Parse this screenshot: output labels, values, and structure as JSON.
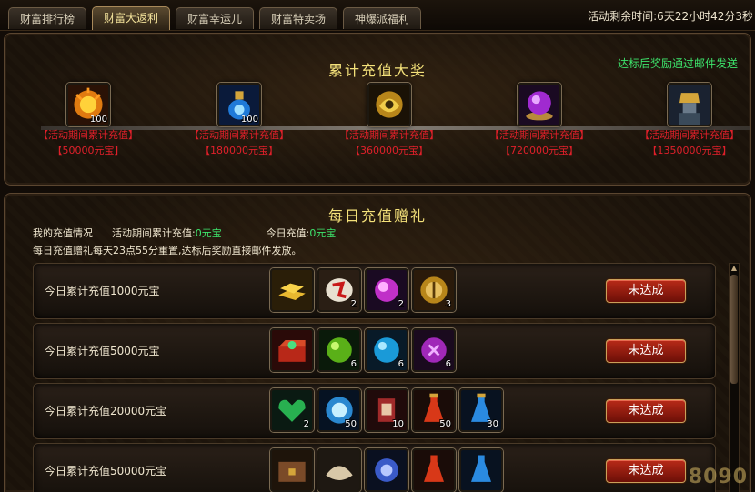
{
  "tabs": [
    {
      "label": "财富排行榜",
      "active": false
    },
    {
      "label": "财富大返利",
      "active": true
    },
    {
      "label": "财富幸运儿",
      "active": false
    },
    {
      "label": "财富特卖场",
      "active": false
    },
    {
      "label": "神爆派福利",
      "active": false
    }
  ],
  "timer": "活动剩余时间:6天22小时42分3秒",
  "cumulative": {
    "title": "累计充值大奖",
    "note": "达标后奖励通过邮件发送",
    "milestones": [
      {
        "icon": "fire-orb-icon",
        "qty": "100",
        "condition": "【活动期间累计充值】",
        "amount": "【50000元宝】"
      },
      {
        "icon": "blue-potion-icon",
        "qty": "100",
        "condition": "【活动期间累计充值】",
        "amount": "【180000元宝】"
      },
      {
        "icon": "gold-dragon-icon",
        "qty": "",
        "condition": "【活动期间累计充值】",
        "amount": "【360000元宝】"
      },
      {
        "icon": "purple-orb-icon",
        "qty": "",
        "condition": "【活动期间累计充值】",
        "amount": "【720000元宝】"
      },
      {
        "icon": "golden-warrior-icon",
        "qty": "",
        "condition": "【活动期间累计充值】",
        "amount": "【1350000元宝】"
      }
    ]
  },
  "daily": {
    "title": "每日充值赠礼",
    "my_status_label": "我的充值情况",
    "period_label": "活动期间累计充值:",
    "period_value": "0元宝",
    "today_label": "今日充值:",
    "today_value": "0元宝",
    "notice": "每日充值赠礼每天23点55分重置,达标后奖励直接邮件发放。",
    "rows": [
      {
        "label": "今日累计充值1000元宝",
        "status": "未达成",
        "items": [
          {
            "icon": "gold-bars-icon",
            "qty": ""
          },
          {
            "icon": "red-rune-stone-icon",
            "qty": "2"
          },
          {
            "icon": "pink-crystal-icon",
            "qty": "2"
          },
          {
            "icon": "golden-compass-icon",
            "qty": "3"
          }
        ]
      },
      {
        "label": "今日累计充值5000元宝",
        "status": "未达成",
        "items": [
          {
            "icon": "treasure-chest-icon",
            "qty": ""
          },
          {
            "icon": "green-orb-icon",
            "qty": "6"
          },
          {
            "icon": "blue-orb-icon",
            "qty": "6"
          },
          {
            "icon": "purple-rune-orb-icon",
            "qty": "6"
          }
        ]
      },
      {
        "label": "今日累计充值20000元宝",
        "status": "未达成",
        "items": [
          {
            "icon": "green-gift-icon",
            "qty": "2"
          },
          {
            "icon": "blue-energy-orb-icon",
            "qty": "50"
          },
          {
            "icon": "red-scroll-icon",
            "qty": "10"
          },
          {
            "icon": "red-potion-icon",
            "qty": "50"
          },
          {
            "icon": "blue-potion-bottle-icon",
            "qty": "30"
          }
        ]
      },
      {
        "label": "今日累计充值50000元宝",
        "status": "未达成",
        "items": [
          {
            "icon": "brown-chest-icon",
            "qty": ""
          },
          {
            "icon": "cloth-bundle-icon",
            "qty": ""
          },
          {
            "icon": "blue-gem-icon",
            "qty": ""
          },
          {
            "icon": "red-potion-icon",
            "qty": ""
          },
          {
            "icon": "blue-potion-bottle-icon",
            "qty": ""
          }
        ]
      }
    ]
  },
  "watermark": "8090"
}
